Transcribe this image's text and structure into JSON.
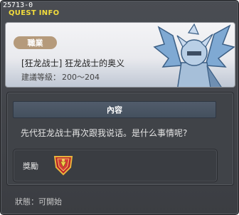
{
  "window": {
    "id": "25713-0",
    "title": "QUEST INFO"
  },
  "quest": {
    "job_label": "職業",
    "name": "[狂龙战士] 狂龙战士的奥义",
    "level_label": "建議等級：",
    "level_range": "200～204"
  },
  "content": {
    "header": "內容",
    "text": "先代狂龙战士再次跟我说话。是什么事情呢?"
  },
  "reward": {
    "label": "獎勵",
    "item_icon": "red-gold-emblem-icon"
  },
  "status": {
    "text": "狀態：可開始"
  },
  "colors": {
    "title": "#f2dc3c",
    "job_badge": "#b59a7b",
    "content_header": "#4b5665"
  }
}
